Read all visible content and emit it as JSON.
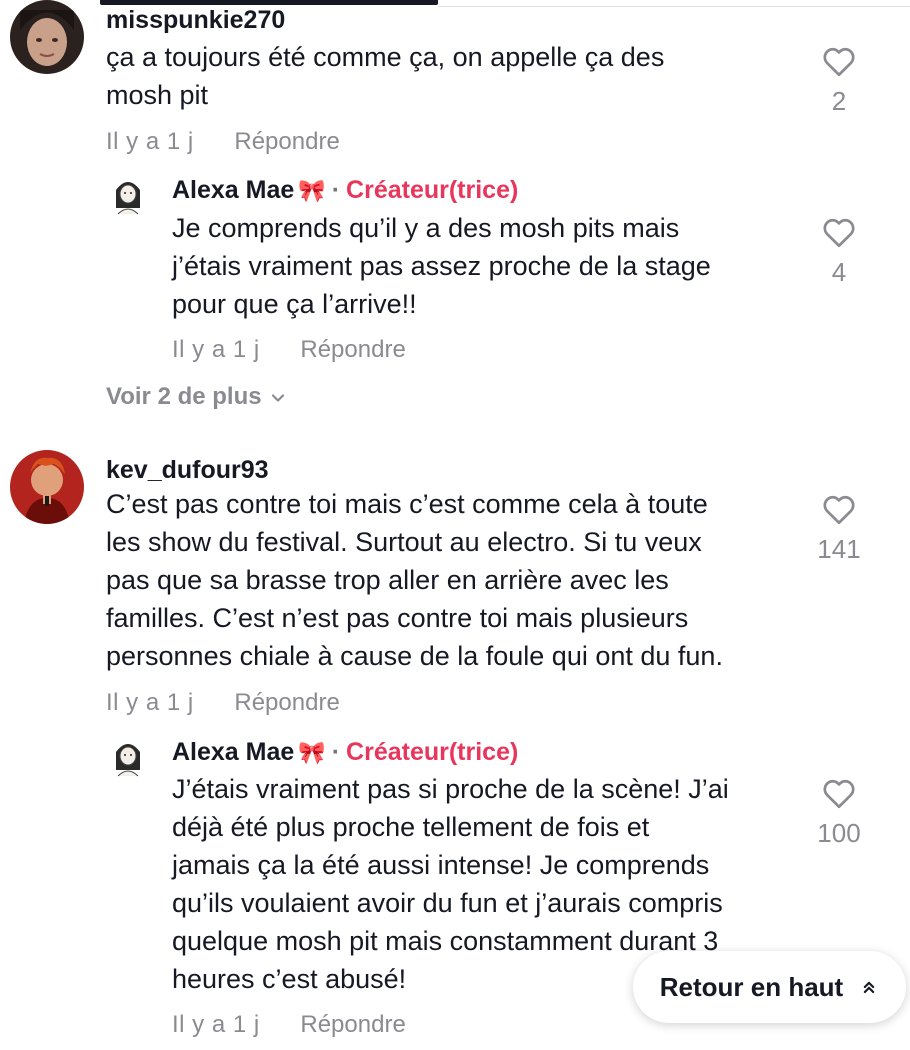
{
  "comments": [
    {
      "username": "misspunkie270",
      "lines": [
        "ça a toujours été comme ça, on appelle ça des",
        "mosh pit"
      ],
      "time": "Il y a 1 j",
      "reply_label": "Répondre",
      "likes": "2"
    },
    {
      "username": "kev_dufour93",
      "lines": [
        "C’est pas contre toi mais c’est comme cela à toute",
        "les show du festival. Surtout au electro. Si tu veux",
        "pas que sa brasse trop aller en arrière avec les",
        "familles. C’est n’est pas contre toi mais plusieurs",
        "personnes chiale à cause de la foule qui ont du fun."
      ],
      "time": "Il y a 1 j",
      "reply_label": "Répondre",
      "likes": "141"
    }
  ],
  "replies": [
    {
      "username": "Alexa Mae",
      "badge_emoji": "🎀",
      "separator": "·",
      "creator_label": "Créateur(trice)",
      "lines": [
        "Je comprends qu’il y a des mosh pits mais",
        "j’étais vraiment pas assez proche de la stage",
        "pour que ça l’arrive!!"
      ],
      "time": "Il y a 1 j",
      "reply_label": "Répondre",
      "likes": "4"
    },
    {
      "username": "Alexa Mae",
      "badge_emoji": "🎀",
      "separator": "·",
      "creator_label": "Créateur(trice)",
      "lines": [
        "J’étais vraiment pas si proche de la scène! J’ai",
        "déjà été plus proche tellement de fois et",
        "jamais ça la été aussi intense! Je comprends",
        "qu’ils voulaient avoir du fun et j’aurais compris",
        "quelque mosh pit mais constamment durant 3",
        "heures c’est abusé!"
      ],
      "time": "Il y a 1 j",
      "reply_label": "Répondre",
      "likes": "100"
    }
  ],
  "view_more": "Voir 2 de plus",
  "back_to_top": "Retour en haut",
  "icons": {
    "like": "heart-outline-icon",
    "view_more": "chevron-down-icon",
    "back_to_top": "double-chevron-up-icon"
  },
  "colors": {
    "creator": "#e8365d",
    "meta": "#8a8b91",
    "text": "#161823"
  }
}
